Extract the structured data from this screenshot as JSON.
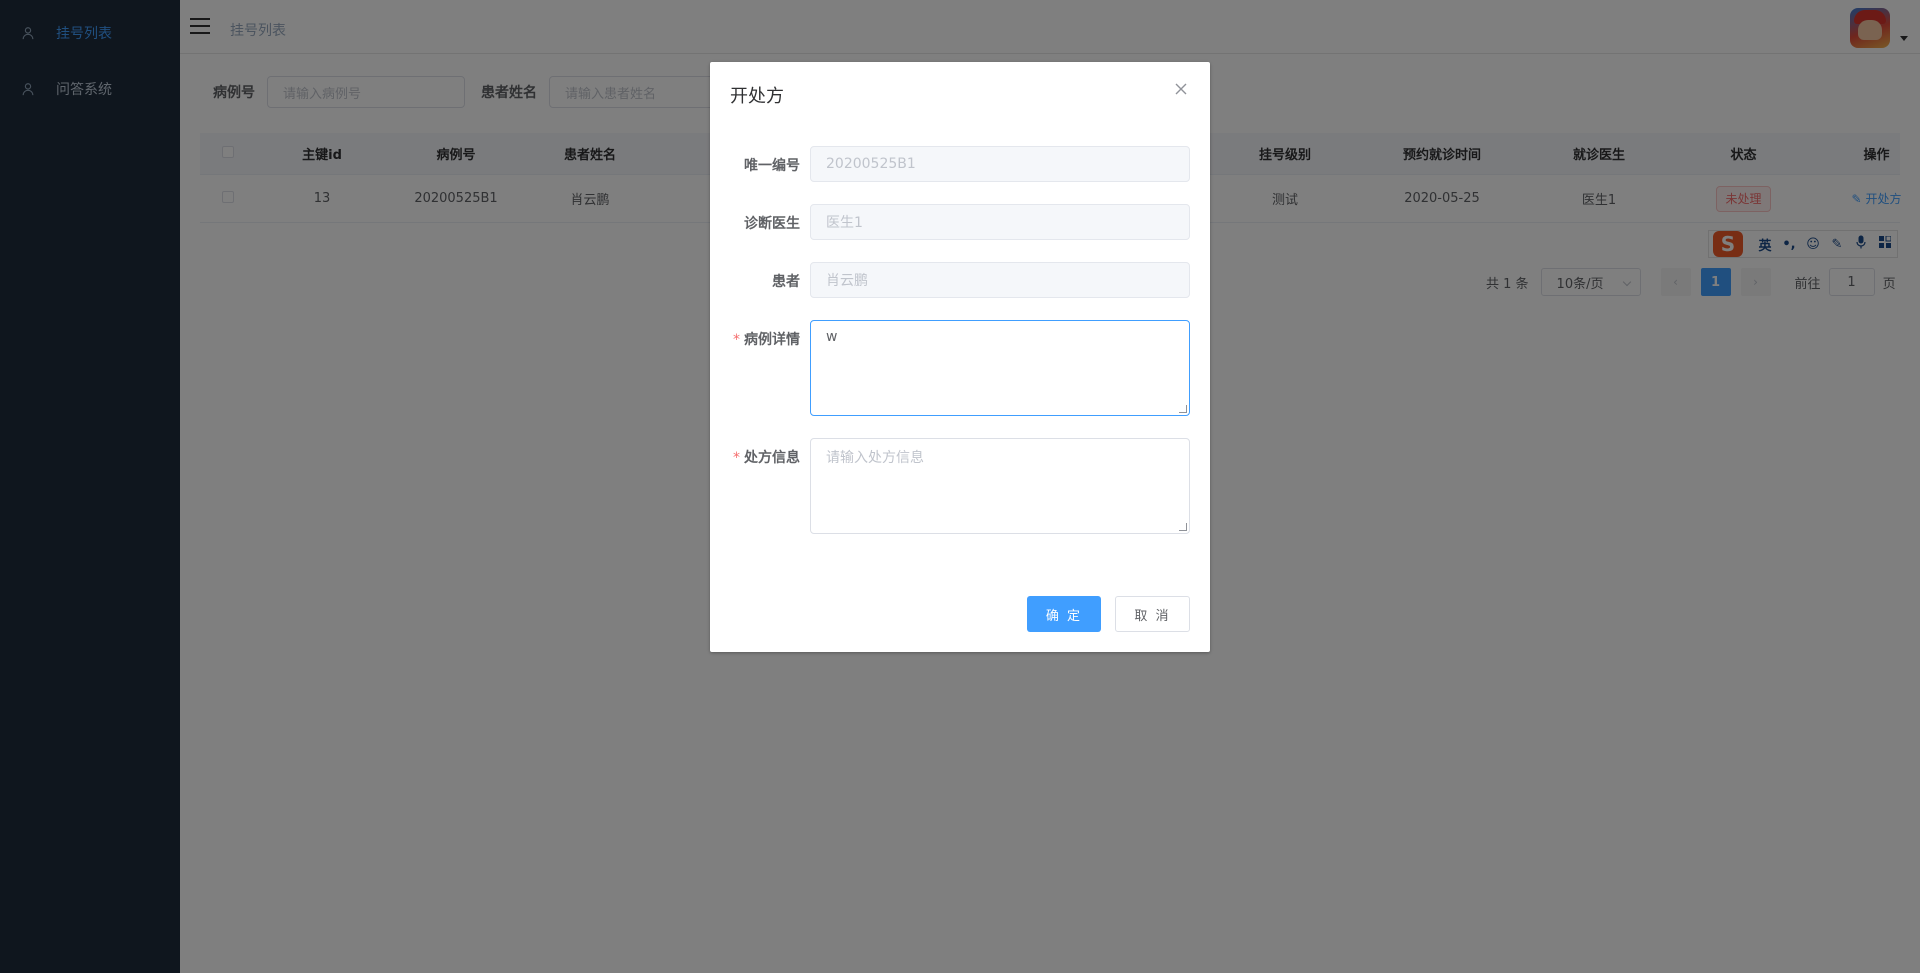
{
  "sidebar": {
    "items": [
      {
        "label": "挂号列表",
        "icon": "user-icon",
        "active": true
      },
      {
        "label": "问答系统",
        "icon": "user-icon",
        "active": false
      }
    ]
  },
  "header": {
    "breadcrumb": "挂号列表"
  },
  "filter": {
    "case_no_label": "病例号",
    "case_no_placeholder": "请输入病例号",
    "patient_name_label": "患者姓名",
    "patient_name_placeholder": "请输入患者姓名"
  },
  "table": {
    "columns": [
      "主键id",
      "病例号",
      "患者姓名",
      "挂号级别",
      "预约就诊时间",
      "就诊医生",
      "状态",
      "操作"
    ],
    "rows": [
      {
        "id": "13",
        "case_no": "20200525B1",
        "patient": "肖云鹏",
        "level": "测试",
        "time": "2020-05-25",
        "doctor": "医生1",
        "status": "未处理",
        "action": "开处方"
      }
    ]
  },
  "pagination": {
    "total": "共 1 条",
    "page_size": "10条/页",
    "current": "1",
    "goto_prefix": "前往",
    "goto_value": "1",
    "goto_suffix": "页"
  },
  "ime": {
    "logo": "S",
    "mode": "英",
    "punct": "•,",
    "icons": [
      "emoji-icon",
      "pen-icon",
      "mic-icon",
      "grid-icon"
    ]
  },
  "dialog": {
    "title": "开处方",
    "fields": {
      "uid_label": "唯一编号",
      "uid_value": "20200525B1",
      "doctor_label": "诊断医生",
      "doctor_value": "医生1",
      "patient_label": "患者",
      "patient_value": "肖云鹏",
      "case_detail_label": "病例详情",
      "case_detail_value": "w",
      "rx_label": "处方信息",
      "rx_placeholder": "请输入处方信息"
    },
    "confirm": "确 定",
    "cancel": "取 消"
  },
  "colors": {
    "primary": "#409eff",
    "sidebar_bg": "#1f2d3d",
    "danger": "#f56c6c"
  }
}
